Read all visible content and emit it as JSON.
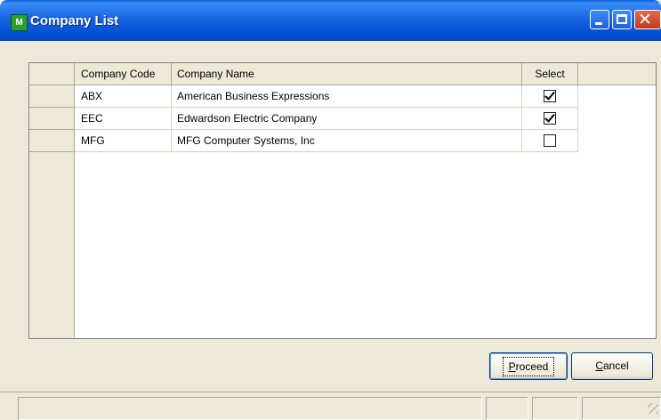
{
  "window": {
    "title": "Company List",
    "icon": "app-icon"
  },
  "controls": {
    "minimize": "minimize-icon",
    "maximize": "maximize-icon",
    "close": "close-icon"
  },
  "grid": {
    "headers": {
      "code": "Company Code",
      "name": "Company Name",
      "select": "Select"
    },
    "rows": [
      {
        "code": "ABX",
        "name": "American Business Expressions",
        "selected": true
      },
      {
        "code": "EEC",
        "name": "Edwardson Electric Company",
        "selected": true
      },
      {
        "code": "MFG",
        "name": "MFG Computer Systems, Inc",
        "selected": false
      }
    ]
  },
  "buttons": {
    "proceed": {
      "mnemonic": "P",
      "rest": "roceed"
    },
    "cancel": {
      "mnemonic": "C",
      "rest": "ancel"
    }
  },
  "colors": {
    "titlebar": "#0a5fd8",
    "window_bg": "#ece9d8",
    "close": "#c33a1a"
  }
}
